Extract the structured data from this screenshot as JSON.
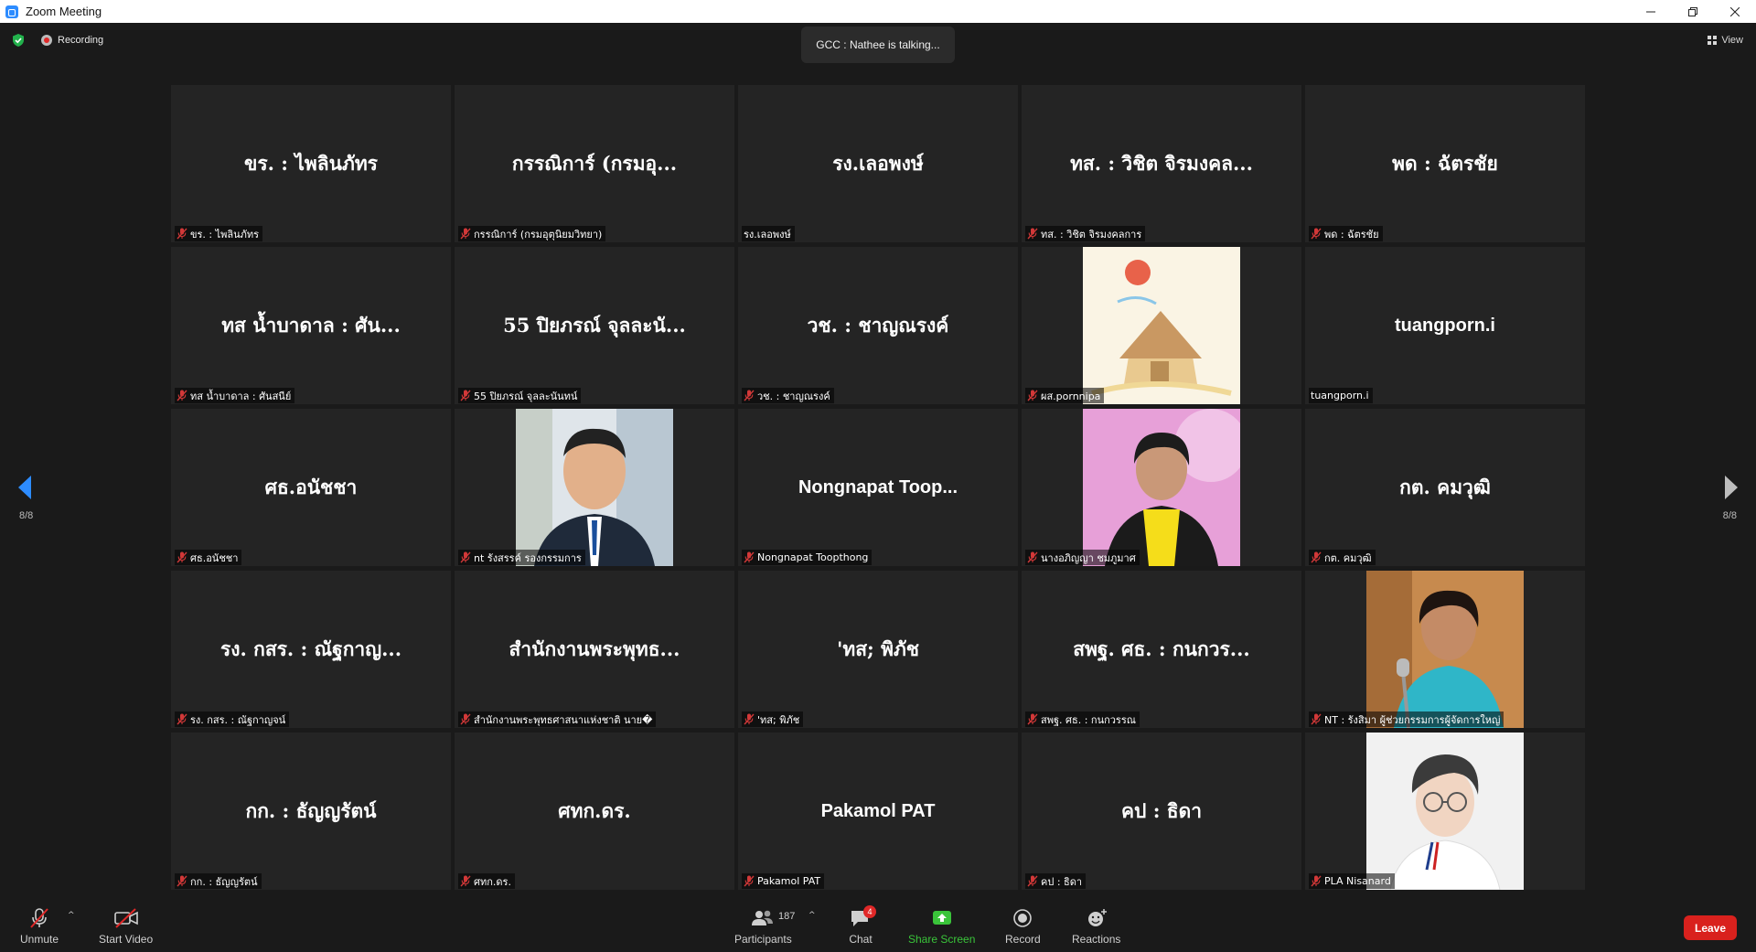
{
  "window": {
    "title": "Zoom Meeting",
    "controls": [
      "minimize-icon",
      "restore-icon",
      "close-icon"
    ]
  },
  "topbar": {
    "recording_label": "Recording",
    "talking_banner": "GCC : Nathee is talking...",
    "view_label": "View"
  },
  "gallery": {
    "page_left": "8/8",
    "page_right": "8/8",
    "tiles": [
      {
        "display": "ขร. : ไพลินภัทร",
        "label": "ขร. : ไพลินภัทร",
        "muted": true,
        "video": false
      },
      {
        "display": "กรรณิการ์ (กรมอุ...",
        "label": "กรรณิการ์ (กรมอุตุนิยมวิทยา)",
        "muted": true,
        "video": false
      },
      {
        "display": "รง.เลอพงษ์",
        "label": "รง.เลอพงษ์",
        "muted": false,
        "video": false
      },
      {
        "display": "ทส. : วิชิต จิรมงคล...",
        "label": "ทส. : วิชิต จิรมงคลการ",
        "muted": true,
        "video": false
      },
      {
        "display": "พด : ฉัตรชัย",
        "label": "พด : ฉัตรชัย",
        "muted": true,
        "video": false
      },
      {
        "display": "ทส น้ำบาดาล : ศัน...",
        "label": "ทส น้ำบาดาล : ศันสนีย์",
        "muted": true,
        "video": false
      },
      {
        "display": "55 ปิยภรณ์ จุลละนั...",
        "label": "55 ปิยภรณ์ จุลละนันทน์",
        "muted": true,
        "video": false
      },
      {
        "display": "วช. : ชาญณรงค์",
        "label": "วช. : ชาญณรงค์",
        "muted": true,
        "video": false
      },
      {
        "display": "",
        "label": "ผส.pornnipa",
        "muted": true,
        "video": true,
        "photo": "house-drawing"
      },
      {
        "display": "tuangporn.i",
        "label": "tuangporn.i",
        "muted": false,
        "video": false
      },
      {
        "display": "ศธ.อนัชชา",
        "label": "ศธ.อนัชชา",
        "muted": true,
        "video": false
      },
      {
        "display": "",
        "label": "nt รังสรรค์ รองกรรมการ",
        "muted": true,
        "video": true,
        "photo": "man-suit"
      },
      {
        "display": "Nongnapat  Toop...",
        "label": "Nongnapat Toopthong",
        "muted": true,
        "video": false
      },
      {
        "display": "",
        "label": "นางอภิญญา ชมภูมาศ",
        "muted": true,
        "video": true,
        "photo": "woman-yellow"
      },
      {
        "display": "กต. คมวุฒิ",
        "label": "กต. คมวุฒิ",
        "muted": true,
        "video": false
      },
      {
        "display": "รง. กสร. : ณัฐกาญ...",
        "label": "รง. กสร. : ณัฐกาญจน์",
        "muted": true,
        "video": false
      },
      {
        "display": "สำนักงานพระพุทธ...",
        "label": "สำนักงานพระพุทธศาสนาแห่งชาติ นาย�",
        "muted": true,
        "video": false
      },
      {
        "display": "'ทส; พิภัช",
        "label": "'ทส; พิภัช",
        "muted": true,
        "video": false
      },
      {
        "display": "สพฐ. ศธ. : กนกวร...",
        "label": "สพฐ. ศธ. : กนกวรรณ",
        "muted": true,
        "video": false
      },
      {
        "display": "",
        "label": "NT : รังสิมา ผู้ช่วยกรรมการผู้จัดการใหญ่",
        "muted": true,
        "video": true,
        "photo": "woman-mic"
      },
      {
        "display": "กก. : ธัญญรัตน์",
        "label": "กก. : ธัญญรัตน์",
        "muted": true,
        "video": false
      },
      {
        "display": "ศทก.ดร.",
        "label": "ศทก.ดร.",
        "muted": true,
        "video": false
      },
      {
        "display": "Pakamol PAT",
        "label": "Pakamol PAT",
        "muted": true,
        "video": false
      },
      {
        "display": "คป : ธิดา",
        "label": "คป : ธิดา",
        "muted": true,
        "video": false
      },
      {
        "display": "",
        "label": "PLA Nisanard",
        "muted": true,
        "video": true,
        "photo": "woman-glasses"
      }
    ]
  },
  "toolbar": {
    "unmute_label": "Unmute",
    "start_video_label": "Start Video",
    "participants_label": "Participants",
    "participants_count": "187",
    "chat_label": "Chat",
    "chat_badge": "4",
    "share_label": "Share Screen",
    "record_label": "Record",
    "reactions_label": "Reactions",
    "leave_label": "Leave"
  },
  "colors": {
    "background": "#1a1a1a",
    "tile": "#242424",
    "leave": "#d9211d",
    "share": "#3ac43a",
    "arrow": "#2d8cff",
    "mic_muted": "#e02828"
  }
}
